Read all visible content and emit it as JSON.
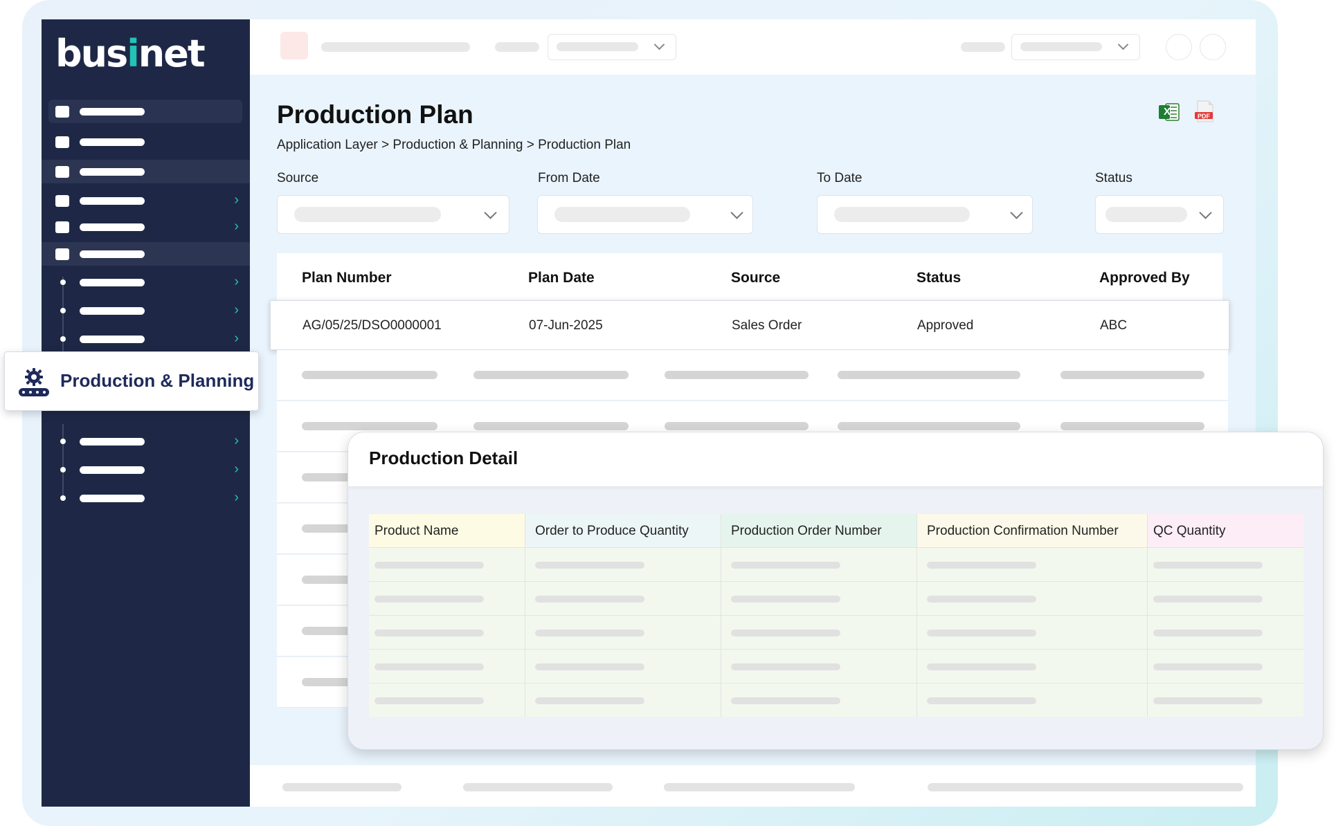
{
  "app": {
    "logo_text_a": "bus",
    "logo_text_i": "i",
    "logo_text_b": "net"
  },
  "sidebar": {
    "highlight_label": "Production & Planning",
    "chevron_glyph": "›"
  },
  "page": {
    "title": "Production Plan",
    "breadcrumb": "Application Layer > Production & Planning > Production Plan",
    "export_icons": [
      "excel-icon",
      "pdf-icon"
    ],
    "pdf_badge": "PDF",
    "excel_badge": "X"
  },
  "filters": {
    "source_label": "Source",
    "from_date_label": "From Date",
    "to_date_label": "To Date",
    "status_label": "Status"
  },
  "plan_table": {
    "headers": [
      "Plan Number",
      "Plan Date",
      "Source",
      "Status",
      "Approved By"
    ],
    "rows": [
      {
        "plan_number": "AG/05/25/DSO0000001",
        "plan_date": "07-Jun-2025",
        "source": "Sales Order",
        "status": "Approved",
        "approved_by": "ABC"
      }
    ]
  },
  "detail": {
    "title": "Production Detail",
    "headers": [
      "Product Name",
      "Order to Produce Quantity",
      "Production Order Number",
      "Production Confirmation Number",
      "QC Quantity"
    ],
    "colors": {
      "product_name": "#fdfbe4",
      "order_qty": "#edf6f7",
      "prod_order": "#e5f5ee",
      "prod_conf": "#fdf9ea",
      "qc_qty": "#fcedf7",
      "body": "#f3f8ee"
    }
  },
  "colors": {
    "sidebar_bg": "#1e2846",
    "accent_teal": "#22c3b6",
    "title_navy": "#1e2a5a"
  }
}
